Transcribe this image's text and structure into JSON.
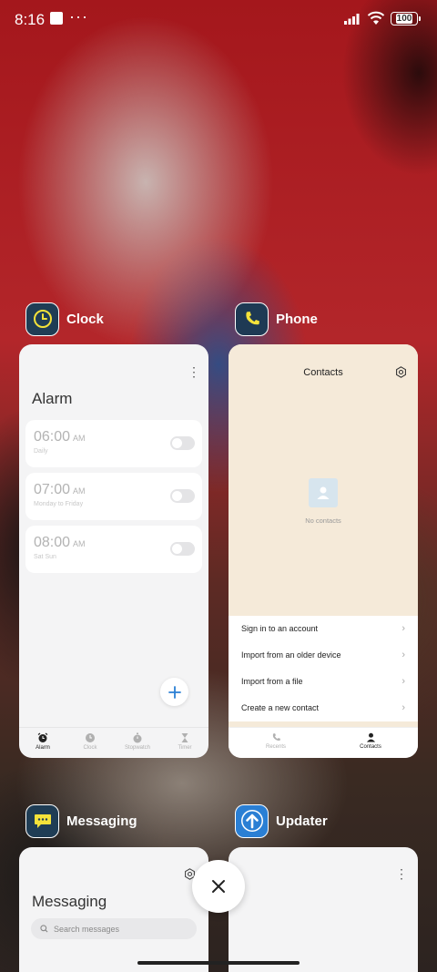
{
  "status_bar": {
    "time": "8:16",
    "more": "···",
    "battery": "100"
  },
  "apps": [
    {
      "name": "Clock",
      "icon": "clock-icon"
    },
    {
      "name": "Phone",
      "icon": "phone-icon"
    },
    {
      "name": "Messaging",
      "icon": "chat-bubble-icon"
    },
    {
      "name": "Updater",
      "icon": "arrow-up-icon"
    }
  ],
  "clock": {
    "title": "Alarm",
    "alarms": [
      {
        "time": "06:00",
        "ampm": "AM",
        "repeat": "Daily",
        "enabled": false
      },
      {
        "time": "07:00",
        "ampm": "AM",
        "repeat": "Monday to Friday",
        "enabled": false
      },
      {
        "time": "08:00",
        "ampm": "AM",
        "repeat": "Sat Sun",
        "enabled": false
      }
    ],
    "nav": [
      "Alarm",
      "Clock",
      "Stopwatch",
      "Timer"
    ]
  },
  "phone": {
    "title": "Contacts",
    "empty_text": "No contacts",
    "menu": [
      "Sign in to an account",
      "Import from an older device",
      "Import from a file",
      "Create a new contact"
    ],
    "nav": [
      "Recents",
      "Contacts"
    ]
  },
  "messaging": {
    "title": "Messaging",
    "search_placeholder": "Search messages"
  },
  "colors": {
    "accent_blue": "#2a7fd4",
    "clock_icon_yellow": "#f4e23a",
    "card_bg": "#f4f4f5",
    "contacts_bg": "#f5ead9"
  }
}
